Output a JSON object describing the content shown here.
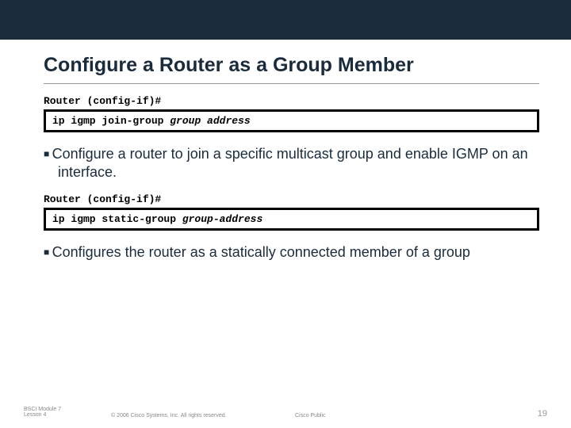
{
  "title": "Configure a Router as a Group Member",
  "block1": {
    "prompt": "Router (config-if)#",
    "cmd_prefix": "ip igmp join-group ",
    "cmd_em": "group address"
  },
  "bullet1": "Configure a router to join a specific multicast group and enable IGMP on an interface.",
  "block2": {
    "prompt": "Router (config-if)#",
    "cmd_prefix": "ip igmp static-group ",
    "cmd_em": "group-address"
  },
  "bullet2": "Configures the router as a statically connected member of a group",
  "footer": {
    "module": "BSCI Module 7 Lesson 4",
    "copyright": "© 2006 Cisco Systems, Inc. All rights reserved.",
    "public": "Cisco Public",
    "page": "19"
  }
}
